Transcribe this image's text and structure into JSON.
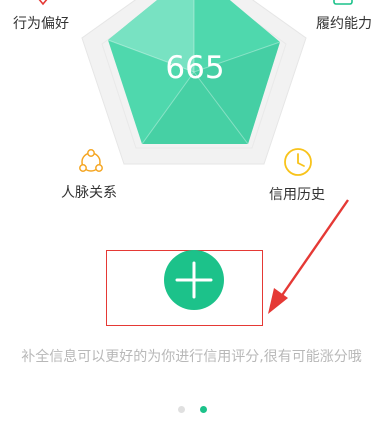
{
  "radar": {
    "score": "665",
    "labels": {
      "behavior": "行为偏好",
      "fulfillment": "履约能力",
      "connections": "人脉关系",
      "credit_history": "信用历史"
    }
  },
  "icons": {
    "behavior": "heart-shield-icon",
    "fulfillment": "plus-square-icon",
    "connections": "network-people-icon",
    "credit_history": "clock-icon",
    "add": "plus-icon"
  },
  "colors": {
    "radar_fill": "#4fd8ad",
    "radar_fill_light": "#7fe4c5",
    "radar_background": "#f2f2f2",
    "add_button": "#1cc28a",
    "connections_icon": "#f5a623",
    "credit_history_icon": "#f8c31b",
    "behavior_icon": "#e53935",
    "highlight": "#e53935",
    "hint_text": "#b8b8b8",
    "dot_active": "#1cc28a",
    "dot_inactive": "#e0e0e0"
  },
  "hint": "补全信息可以更好的为你进行信用评分,很有可能涨分哦",
  "pagination": {
    "active_index": 1,
    "total": 2
  }
}
